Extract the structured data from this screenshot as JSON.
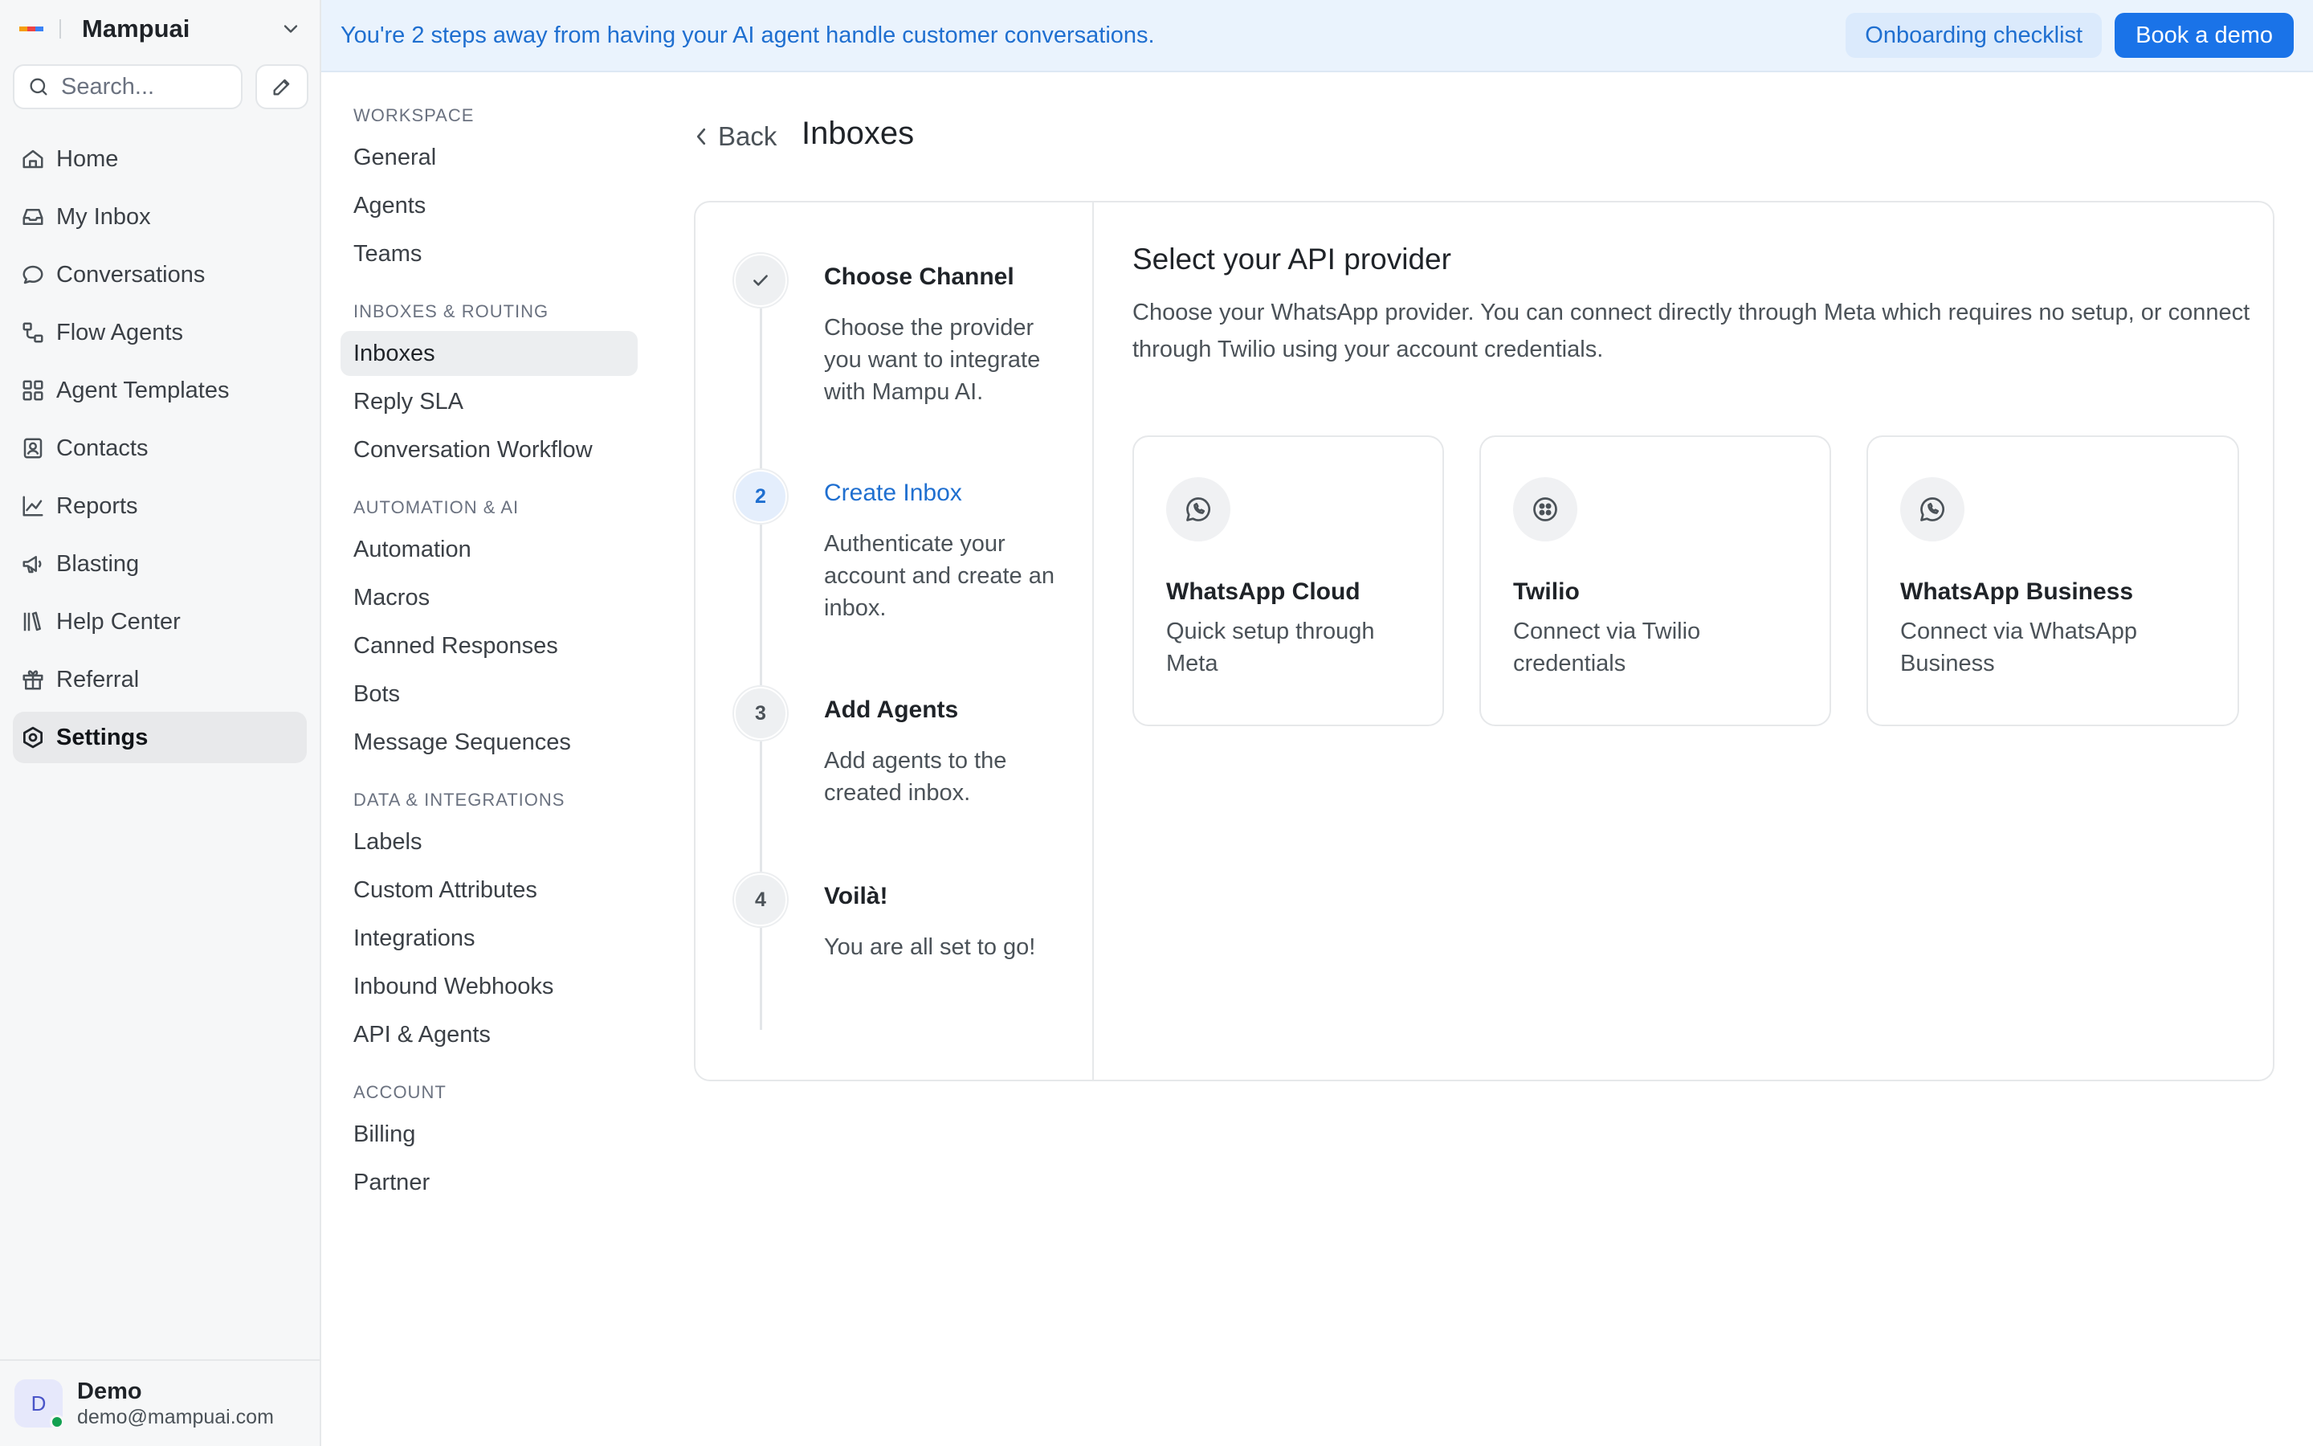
{
  "workspace": {
    "name": "Mampuai",
    "logo_colors": [
      "#f59e0b",
      "#ef4444",
      "#3b82f6"
    ]
  },
  "search": {
    "placeholder": "Search..."
  },
  "nav": {
    "items": [
      {
        "label": "Home",
        "icon": "home-icon"
      },
      {
        "label": "My Inbox",
        "icon": "inbox-icon"
      },
      {
        "label": "Conversations",
        "icon": "chat-icon"
      },
      {
        "label": "Flow Agents",
        "icon": "flow-icon"
      },
      {
        "label": "Agent Templates",
        "icon": "grid-icon"
      },
      {
        "label": "Contacts",
        "icon": "contacts-icon"
      },
      {
        "label": "Reports",
        "icon": "chart-icon"
      },
      {
        "label": "Blasting",
        "icon": "megaphone-icon"
      },
      {
        "label": "Help Center",
        "icon": "library-icon"
      },
      {
        "label": "Referral",
        "icon": "gift-icon"
      },
      {
        "label": "Settings",
        "icon": "settings-icon"
      }
    ],
    "active": "Settings"
  },
  "user": {
    "initial": "D",
    "name": "Demo",
    "email": "demo@mampuai.com"
  },
  "banner": {
    "message": "You're 2 steps away from having your AI agent handle customer conversations.",
    "checklist_label": "Onboarding checklist",
    "demo_label": "Book a demo"
  },
  "settings_nav": {
    "sections": [
      {
        "title": "WORKSPACE",
        "items": [
          "General",
          "Agents",
          "Teams"
        ]
      },
      {
        "title": "INBOXES & ROUTING",
        "items": [
          "Inboxes",
          "Reply SLA",
          "Conversation Workflow"
        ]
      },
      {
        "title": "AUTOMATION & AI",
        "items": [
          "Automation",
          "Macros",
          "Canned Responses",
          "Bots",
          "Message Sequences"
        ]
      },
      {
        "title": "DATA & INTEGRATIONS",
        "items": [
          "Labels",
          "Custom Attributes",
          "Integrations",
          "Inbound Webhooks",
          "API & Agents"
        ]
      },
      {
        "title": "ACCOUNT",
        "items": [
          "Billing",
          "Partner"
        ]
      }
    ],
    "active": "Inboxes"
  },
  "page": {
    "back_label": "Back",
    "title": "Inboxes"
  },
  "steps": [
    {
      "marker": "✓",
      "title": "Choose Channel",
      "desc": "Choose the provider you want to integrate with Mampu AI.",
      "state": "done"
    },
    {
      "marker": "2",
      "title": "Create Inbox",
      "desc": "Authenticate your account and create an inbox.",
      "state": "current"
    },
    {
      "marker": "3",
      "title": "Add Agents",
      "desc": "Add agents to the created inbox.",
      "state": "todo"
    },
    {
      "marker": "4",
      "title": "Voilà!",
      "desc": "You are all set to go!",
      "state": "todo"
    }
  ],
  "provider": {
    "heading": "Select your API provider",
    "description": "Choose your WhatsApp provider. You can connect directly through Meta which requires no setup, or connect through Twilio using your account credentials.",
    "cards": [
      {
        "title": "WhatsApp Cloud",
        "desc": "Quick setup through Meta",
        "icon": "whatsapp-icon"
      },
      {
        "title": "Twilio",
        "desc": "Connect via Twilio credentials",
        "icon": "twilio-icon"
      },
      {
        "title": "WhatsApp Business",
        "desc": "Connect via WhatsApp Business",
        "icon": "whatsapp-icon"
      }
    ]
  },
  "colors": {
    "accent": "#1a73e8",
    "banner_bg": "#eaf3fd",
    "sidebar_bg": "#f6f7f8"
  }
}
